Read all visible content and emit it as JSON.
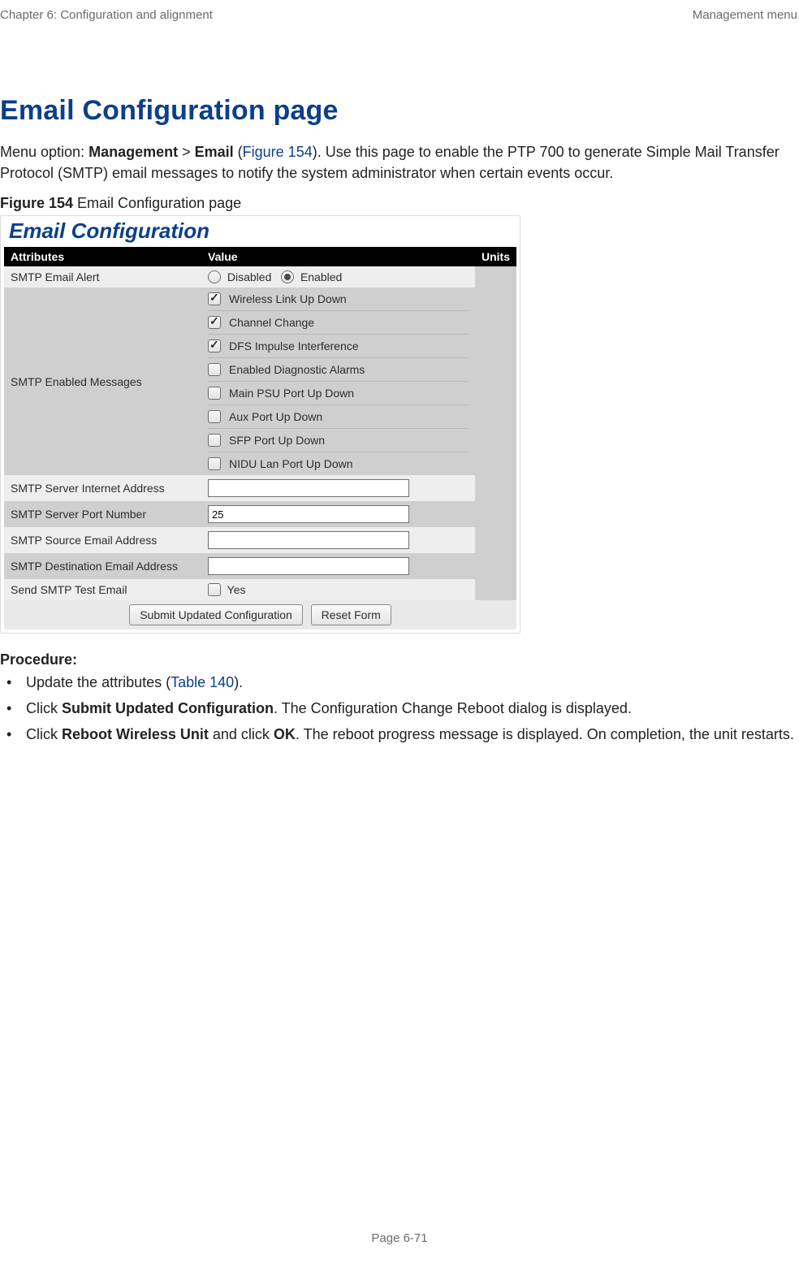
{
  "header": {
    "left": "Chapter 6:  Configuration and alignment",
    "right": "Management menu"
  },
  "title": "Email Configuration page",
  "intro": {
    "prefix": "Menu option: ",
    "menu1": "Management",
    "sep": " > ",
    "menu2": "Email",
    "paren_open": " (",
    "fig_link": "Figure 154",
    "paren_close": "). ",
    "rest": "Use this page to enable the PTP 700 to generate Simple Mail Transfer Protocol (SMTP) email messages to notify the system administrator when certain events occur."
  },
  "figure_caption": {
    "bold": "Figure 154",
    "rest": "  Email Configuration page"
  },
  "ui": {
    "panel_title": "Email Configuration",
    "headers": {
      "attr": "Attributes",
      "value": "Value",
      "units": "Units"
    },
    "rows": {
      "alert": {
        "attr": "SMTP Email Alert",
        "disabled_label": "Disabled",
        "enabled_label": "Enabled"
      },
      "messages": {
        "attr": "SMTP Enabled Messages",
        "items": [
          {
            "label": "Wireless Link Up Down",
            "checked": true
          },
          {
            "label": "Channel Change",
            "checked": true
          },
          {
            "label": "DFS Impulse Interference",
            "checked": true
          },
          {
            "label": "Enabled Diagnostic Alarms",
            "checked": false
          },
          {
            "label": "Main PSU Port Up Down",
            "checked": false
          },
          {
            "label": "Aux Port Up Down",
            "checked": false
          },
          {
            "label": "SFP Port Up Down",
            "checked": false
          },
          {
            "label": "NIDU Lan Port Up Down",
            "checked": false
          }
        ]
      },
      "server_addr": {
        "attr": "SMTP Server Internet Address",
        "value": ""
      },
      "server_port": {
        "attr": "SMTP Server Port Number",
        "value": "25"
      },
      "source_email": {
        "attr": "SMTP Source Email Address",
        "value": ""
      },
      "dest_email": {
        "attr": "SMTP Destination Email Address",
        "value": ""
      },
      "test_email": {
        "attr": "Send SMTP Test Email",
        "yes_label": "Yes",
        "checked": false
      }
    },
    "buttons": {
      "submit": "Submit Updated Configuration",
      "reset": "Reset Form"
    }
  },
  "procedure": {
    "heading": "Procedure:",
    "items": [
      {
        "pre": "Update the attributes (",
        "link": "Table 140",
        "post": ")."
      },
      {
        "pre": "Click ",
        "bold": "Submit Updated Configuration",
        "post": ". The Configuration Change Reboot dialog is displayed."
      },
      {
        "pre": "Click ",
        "bold": "Reboot Wireless Unit",
        "mid": " and click ",
        "bold2": "OK",
        "post": ". The reboot progress message is displayed. On completion, the unit restarts."
      }
    ]
  },
  "footer": "Page 6-71"
}
